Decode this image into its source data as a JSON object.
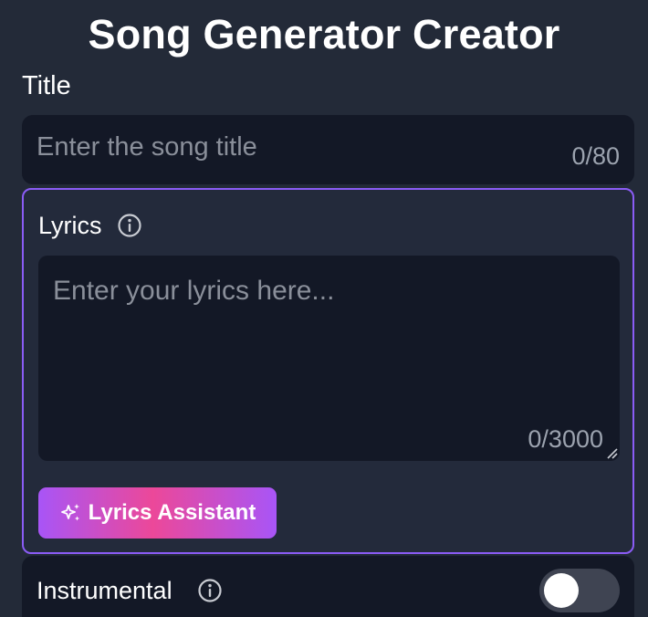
{
  "header": {
    "title": "Song Generator Creator"
  },
  "title_section": {
    "label": "Title",
    "placeholder": "Enter the song title",
    "value": "",
    "counter": "0/80"
  },
  "lyrics_section": {
    "label": "Lyrics",
    "info_icon": "info-icon",
    "placeholder": "Enter your lyrics here...",
    "value": "",
    "counter": "0/3000",
    "assistant_button_label": "Lyrics Assistant",
    "assistant_icon": "sparkle-icon",
    "accent_color": "#8b5cf6"
  },
  "instrumental": {
    "label": "Instrumental",
    "info_icon": "info-icon",
    "enabled": false
  },
  "colors": {
    "background": "#232a38",
    "field": "#131826",
    "gradient_start": "#a855f7",
    "gradient_mid": "#ec4899"
  }
}
